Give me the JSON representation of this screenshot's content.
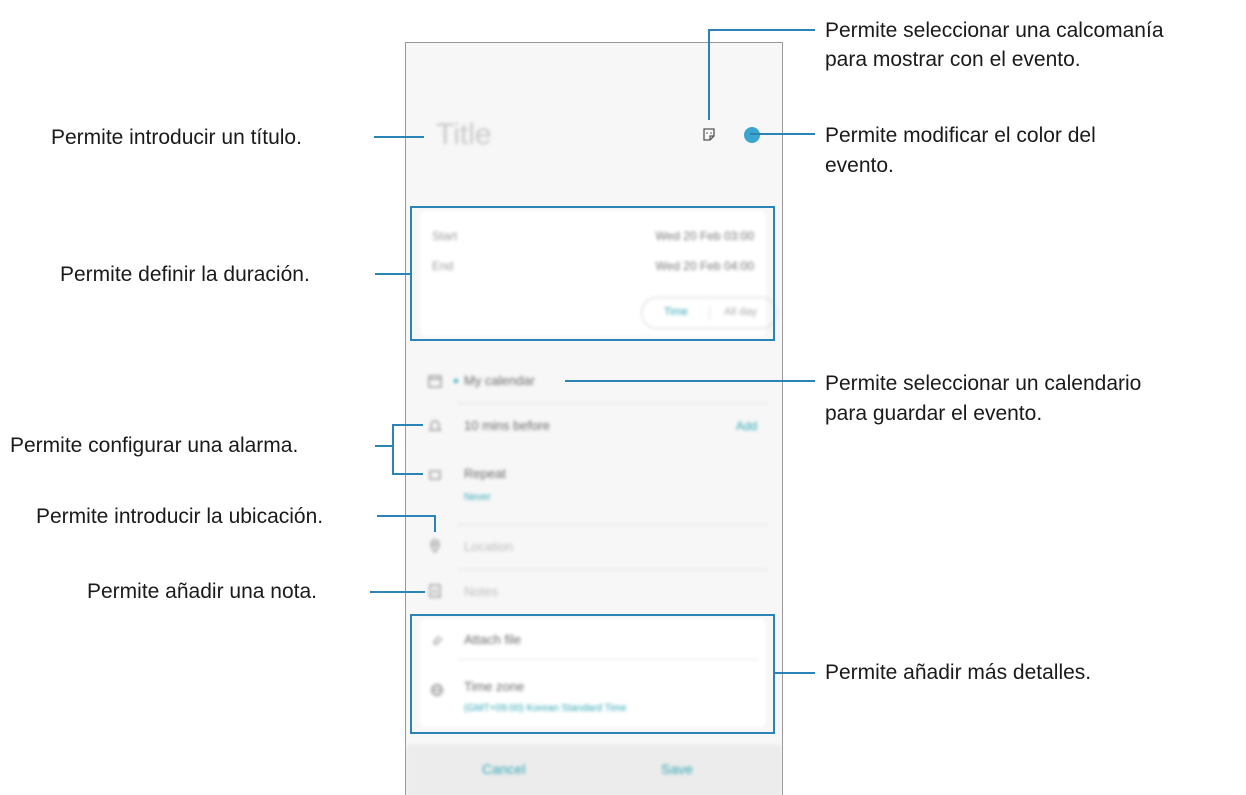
{
  "phone": {
    "title_placeholder": "Title",
    "start_label": "Start",
    "start_value": "Wed 20 Feb  03:00",
    "end_label": "End",
    "end_value": "Wed 20 Feb  04:00",
    "time_toggle": "Time",
    "all_day_toggle": "All day",
    "calendar_name": "My calendar",
    "alarm": "10 mins before",
    "alarm_add": "Add",
    "repeat": "Repeat",
    "repeat_value": "Never",
    "location_placeholder": "Location",
    "notes_placeholder": "Notes",
    "attach_file": "Attach file",
    "time_zone": "Time zone",
    "time_zone_value": "(GMT+09:00) Korean Standard Time",
    "cancel": "Cancel",
    "save": "Save",
    "accent_color": "#2fa7b5",
    "event_color": "#3aa6cf"
  },
  "callouts": {
    "sticker_line1": "Permite seleccionar una calcomanía",
    "sticker_line2": "para mostrar con el evento.",
    "title": "Permite introducir un título.",
    "color_line1": "Permite modificar el color del",
    "color_line2": "evento.",
    "duration": "Permite definir la duración.",
    "calendar_line1": "Permite seleccionar un calendario",
    "calendar_line2": "para guardar el evento.",
    "alarm": "Permite configurar una alarma.",
    "location": "Permite introducir la ubicación.",
    "note": "Permite añadir una nota.",
    "details": "Permite añadir más detalles.",
    "line_color": "#2a84b8"
  }
}
